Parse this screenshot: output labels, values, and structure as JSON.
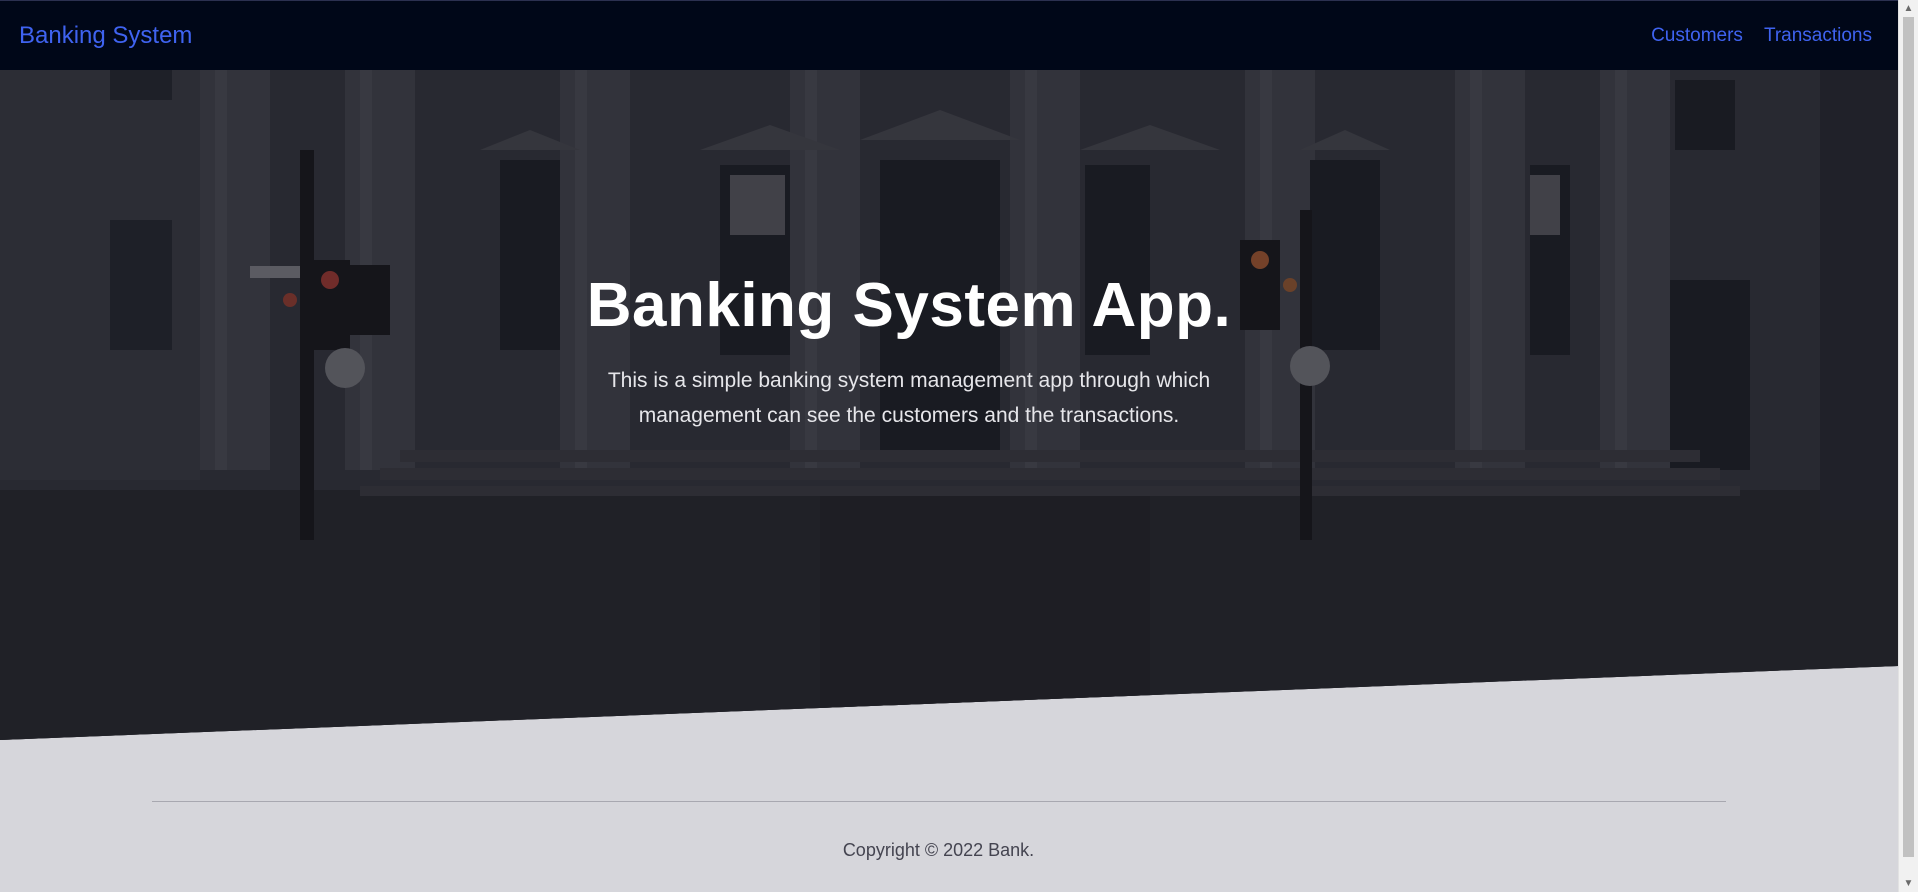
{
  "navbar": {
    "brand": "Banking System",
    "links": [
      {
        "label": "Customers"
      },
      {
        "label": "Transactions"
      }
    ],
    "accent_color": "#3f63f0",
    "background_color": "#000718"
  },
  "hero": {
    "title": "Banking System App.",
    "description": "This is a simple banking system management app through which management can see the customers and the transactions.",
    "background_image": "bank-building-photo"
  },
  "footer": {
    "copyright": "Copyright © 2022 Bank."
  },
  "scrollbar": {
    "up_icon": "scroll-up-arrow-icon",
    "down_icon": "scroll-down-arrow-icon"
  }
}
